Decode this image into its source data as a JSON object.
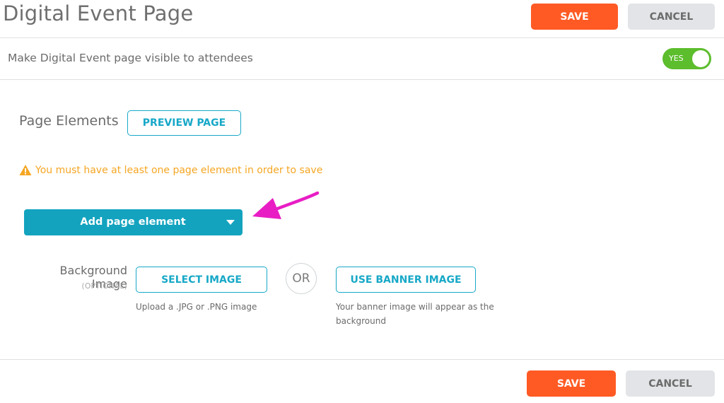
{
  "header": {
    "title": "Digital Event Page",
    "save_label": "SAVE",
    "cancel_label": "CANCEL"
  },
  "visibility": {
    "label": "Make Digital Event page visible to attendees",
    "toggle_text": "YES",
    "enabled": true
  },
  "page_elements": {
    "title": "Page Elements",
    "preview_label": "PREVIEW PAGE",
    "warning": "You must have at least one page element in order to save",
    "add_label": "Add page element"
  },
  "background": {
    "label": "Background Image",
    "optional": "(OPTIONAL)",
    "select_label": "SELECT IMAGE",
    "select_help": "Upload a .JPG or .PNG image",
    "or_label": "OR",
    "banner_label": "USE BANNER IMAGE",
    "banner_help_line1": "Your banner image will appear as the",
    "banner_help_line2": "background"
  },
  "footer": {
    "save_label": "SAVE",
    "cancel_label": "CANCEL"
  },
  "colors": {
    "save": "#ff5a24",
    "accent": "#17a8c7",
    "toggle_on": "#5cbd2d",
    "warning": "#f5a623",
    "arrow": "#e81ec4"
  }
}
